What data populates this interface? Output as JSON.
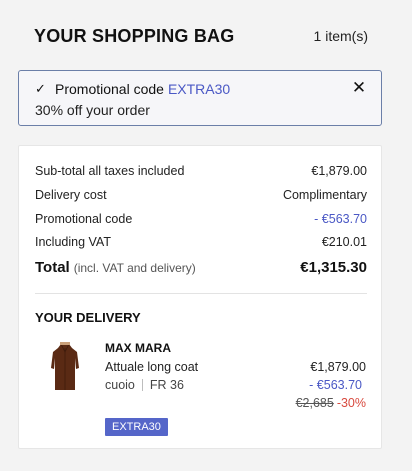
{
  "header": {
    "title": "YOUR SHOPPING BAG",
    "item_count": "1 item(s)"
  },
  "promo": {
    "label": "Promotional code",
    "code": "EXTRA30",
    "description": "30% off your order",
    "check_icon": "check-icon",
    "close_icon": "close-icon"
  },
  "summary": {
    "subtotal_label": "Sub-total all taxes included",
    "subtotal_value": "€1,879.00",
    "delivery_label": "Delivery cost",
    "delivery_value": "Complimentary",
    "promo_label": "Promotional code",
    "promo_value": "- €563.70",
    "vat_label": "Including VAT",
    "vat_value": "€210.01",
    "total_label": "Total",
    "total_note": "(incl. VAT and delivery)",
    "total_value": "€1,315.30"
  },
  "delivery": {
    "title": "YOUR DELIVERY",
    "item": {
      "brand": "MAX MARA",
      "name": "Attuale long coat",
      "color": "cuoio",
      "size": "FR 36",
      "price": "€1,879.00",
      "discount": "- €563.70",
      "original_price": "€2,685",
      "discount_pct": "-30%",
      "badge": "EXTRA30"
    }
  },
  "colors": {
    "accent": "#4a58c5",
    "badge_bg": "#5566c9",
    "sale_red": "#d84a3f",
    "promo_border": "#6b7fa8",
    "coat": "#5a2a14"
  }
}
